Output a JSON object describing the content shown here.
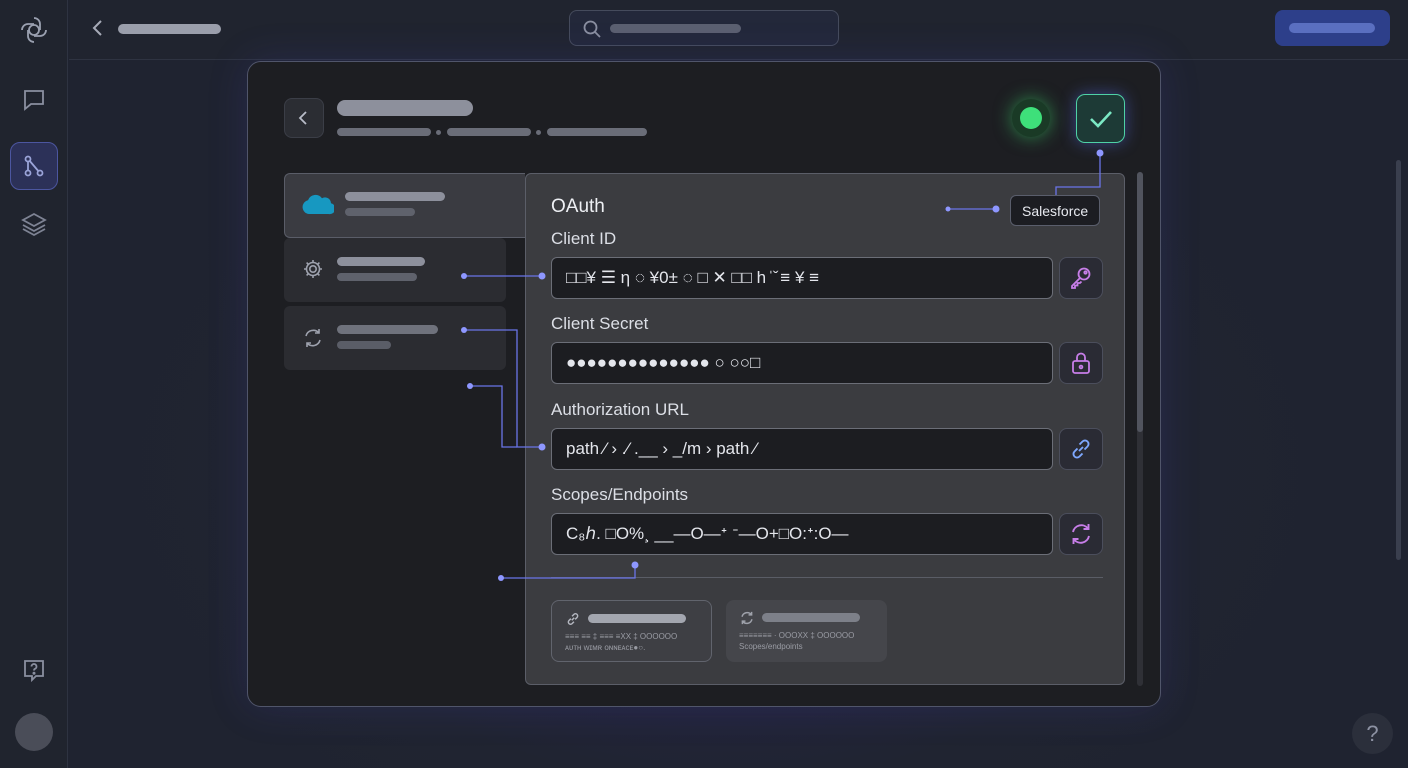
{
  "form": {
    "section_title": "OAuth",
    "provider_tag": "Salesforce",
    "fields": [
      {
        "label": "Client ID",
        "value": "□□¥ ☰ η ◌ ¥0± ◌ □ ✕ □□ h ̍ ̌ ≡ ¥ ≡",
        "icon": "key-icon"
      },
      {
        "label": "Client Secret",
        "value": "●●●●●●●●●●●●●● ○ ○○□",
        "icon": "lock-icon"
      },
      {
        "label": "Authorization URL",
        "value": "path ⁄ › .⁄ .__ › _/m › path ⁄",
        "icon": "link-icon"
      },
      {
        "label": "Scopes/Endpoints",
        "value": "C₈ℎ. □O%¸ __—O—ᐩ ᐨ—O+□O:ᐩ:O—",
        "icon": "refresh-icon"
      }
    ]
  },
  "cards": [
    {
      "small_text": "≡≡≡ ≡≡ ‡ ≡≡≡ ≡XX ‡ OOOOOO",
      "caption": "ᴀᴜᴛʜ ᴡɪᴍʀ ᴏɴɴᴇᴀᴄᴇ●○.",
      "icon": "link-icon"
    },
    {
      "small_text": "≡≡≡≡≡≡≡ · OOOXX ‡ OOOOOO",
      "caption": "Scopes/endpoints",
      "icon": "refresh-icon"
    }
  ],
  "status": {
    "connected": true,
    "color": "#3ee07a"
  },
  "colors": {
    "accent": "#6a78ff",
    "salesforce": "#1798c1",
    "success": "#4fd2a6"
  }
}
